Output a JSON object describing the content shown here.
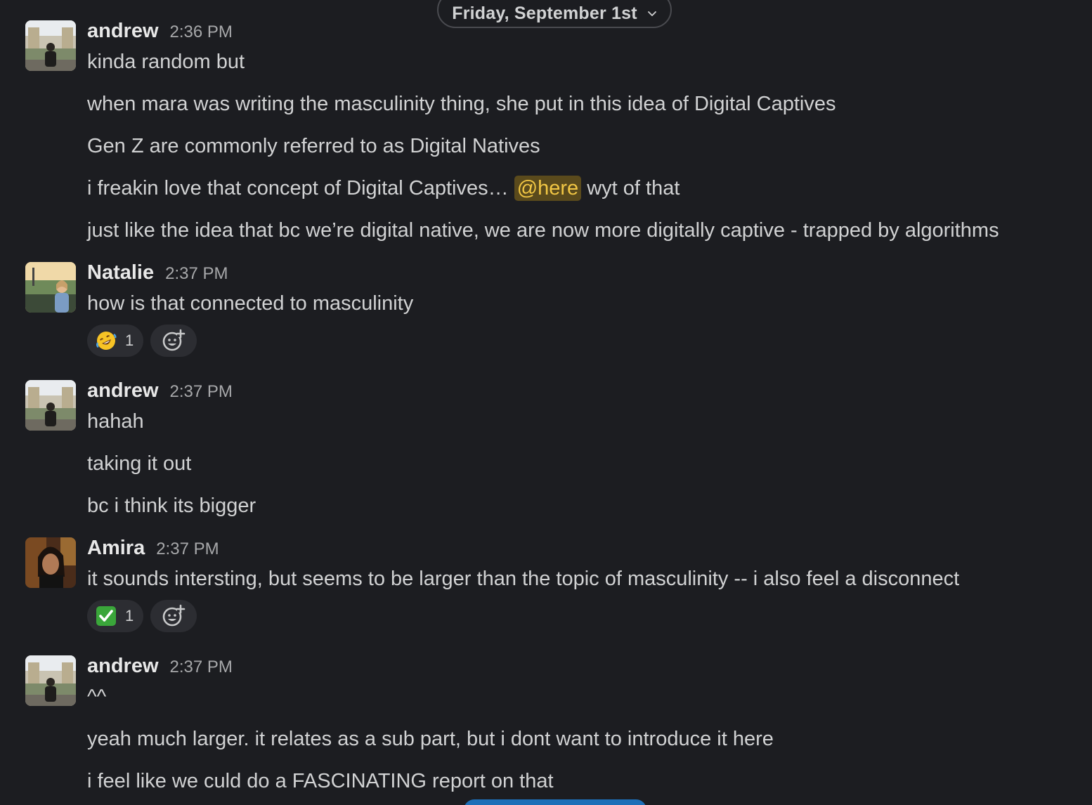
{
  "date_divider": {
    "label": "Friday, September 1st"
  },
  "colors": {
    "background": "#1c1d21",
    "mention_bg": "#5a4a1c",
    "mention_text": "#f2c744",
    "reaction_bg": "#2c2d32",
    "checkmark_green": "#3aa63a"
  },
  "messages": [
    {
      "author": "andrew",
      "time": "2:36 PM",
      "lines": [
        "kinda random but",
        "when mara was writing the masculinity thing, she put in this idea of Digital Captives",
        "Gen Z are commonly referred to as Digital Natives",
        {
          "before": "i freakin love that concept of Digital Captives… ",
          "mention": "@here",
          "after": " wyt of that"
        },
        "just like the idea that bc we’re digital native, we are now more digitally captive - trapped by algorithms"
      ]
    },
    {
      "author": "Natalie",
      "time": "2:37 PM",
      "lines": [
        "how is that connected to masculinity"
      ],
      "reactions": [
        {
          "emoji": "rolling-on-floor-laughing-emoji",
          "count": "1"
        }
      ]
    },
    {
      "author": "andrew",
      "time": "2:37 PM",
      "lines": [
        "hahah",
        "taking it out",
        "bc i think its bigger"
      ]
    },
    {
      "author": "Amira",
      "time": "2:37 PM",
      "lines": [
        "it sounds intersting, but seems to be larger than the topic of masculinity -- i also feel a disconnect"
      ],
      "reactions": [
        {
          "emoji": "white-check-mark-emoji",
          "count": "1"
        }
      ]
    },
    {
      "author": "andrew",
      "time": "2:37 PM",
      "lines": [
        "^^",
        "yeah much larger. it relates as a sub part, but i dont want to introduce it here",
        "i feel like we culd do a FASCINATING report on that"
      ]
    }
  ]
}
